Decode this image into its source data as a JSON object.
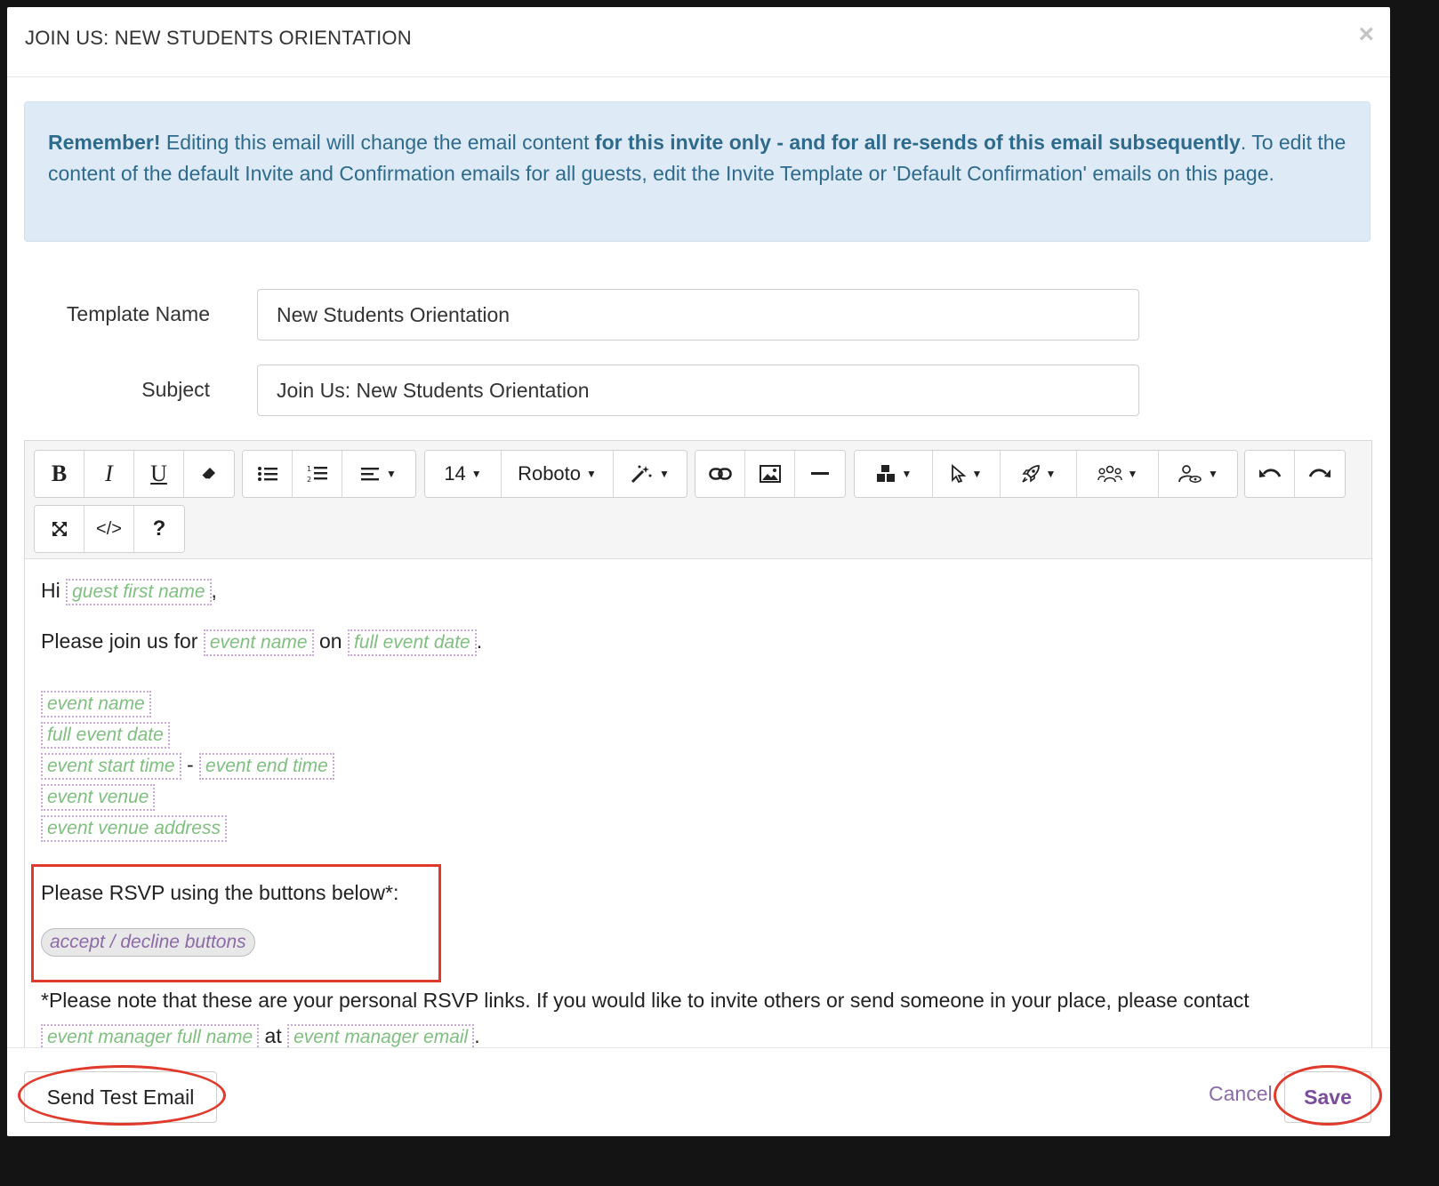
{
  "modal": {
    "title": "JOIN US: NEW STUDENTS ORIENTATION",
    "close_icon": "×"
  },
  "alert": {
    "strong_lead": "Remember!",
    "text1": " Editing this email will change the email content ",
    "strong_mid": "for this invite only - and for all re-sends of this email subsequently",
    "text2": ". To edit the content of the default Invite and Confirmation emails for all guests, edit the Invite Template or 'Default Confirmation' emails on this page."
  },
  "form": {
    "template_name_label": "Template Name",
    "template_name_value": "New Students Orientation",
    "subject_label": "Subject",
    "subject_value": "Join Us: New Students Orientation"
  },
  "toolbar": {
    "font_size": "14",
    "font_family": "Roboto",
    "bold": "B",
    "italic": "I",
    "underline": "U",
    "code": "</>",
    "help": "?"
  },
  "body": {
    "hi": "Hi",
    "comma": ",",
    "join_text": "Please join us for",
    "on_text": "on",
    "period": ".",
    "dash": "-",
    "rsvp_text": "Please RSVP using the buttons below*:",
    "note_text": "*Please note that these are your personal RSVP links. If you would like to invite others or send someone in your place, please contact",
    "at_text": "at",
    "tags": {
      "guest_first_name": "guest first name",
      "event_name": "event name",
      "full_event_date": "full event date",
      "event_start_time": "event start time",
      "event_end_time": "event end time",
      "event_venue": "event venue",
      "event_venue_address": "event venue address",
      "accept_decline": "accept / decline buttons",
      "event_manager_full_name": "event manager full name",
      "event_manager_email": "event manager email"
    }
  },
  "footer": {
    "send_test": "Send Test Email",
    "cancel": "Cancel",
    "save": "Save"
  }
}
